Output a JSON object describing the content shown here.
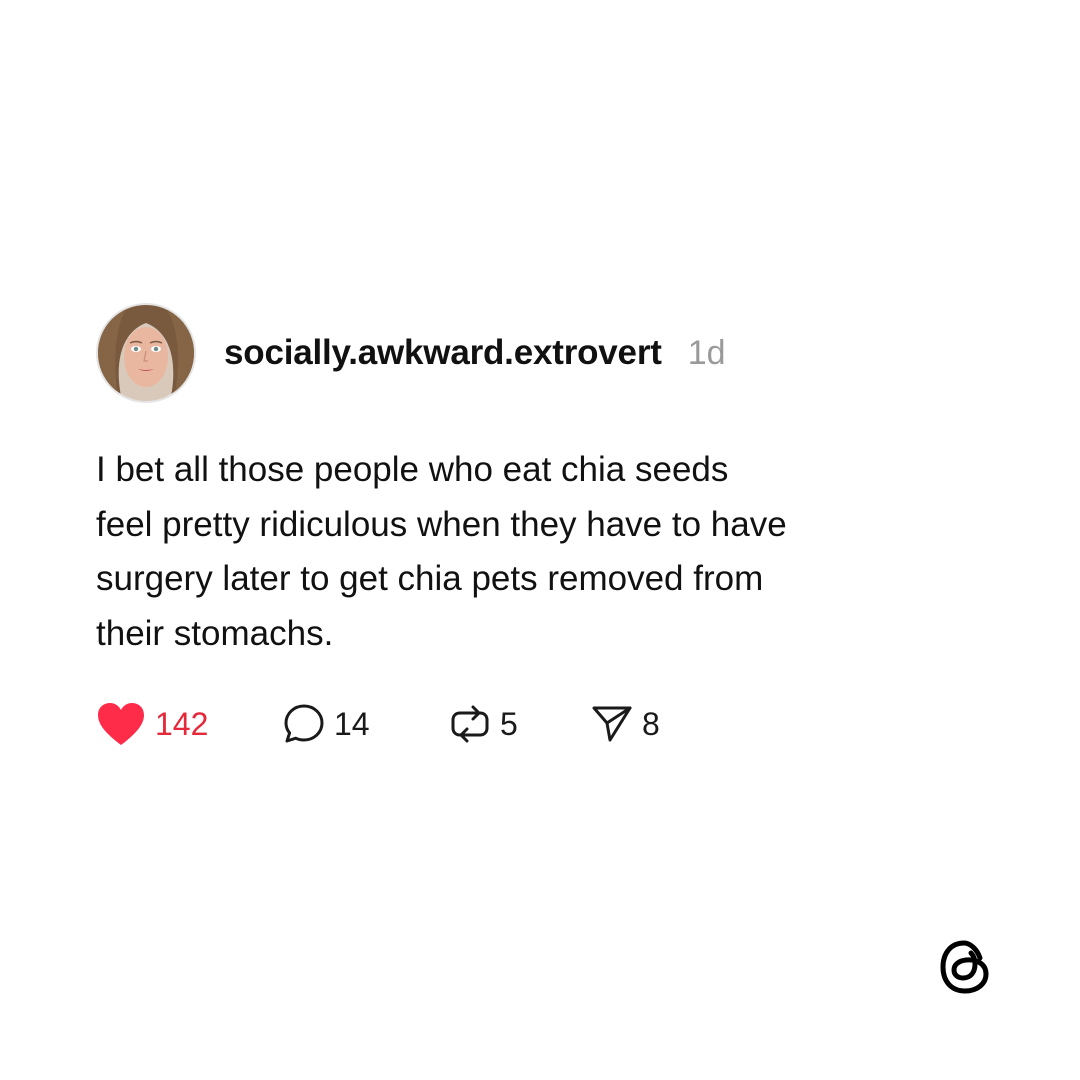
{
  "post": {
    "username": "socially.awkward.extrovert",
    "timestamp": "1d",
    "lines": [
      "I bet all those people who eat chia seeds",
      "feel pretty ridiculous when they have to have",
      "surgery later to get chia pets removed from",
      "their stomachs."
    ],
    "actions": {
      "likes": "142",
      "replies": "14",
      "reposts": "5",
      "shares": "8"
    }
  },
  "icons": {
    "like": "heart-icon",
    "reply": "comment-bubble-icon",
    "repost": "repost-icon",
    "share": "send-icon",
    "brand": "threads-logo-icon"
  },
  "colors": {
    "like": "#e5283a",
    "text": "#111111",
    "muted": "#9a9a9a",
    "background": "#ffffff"
  }
}
